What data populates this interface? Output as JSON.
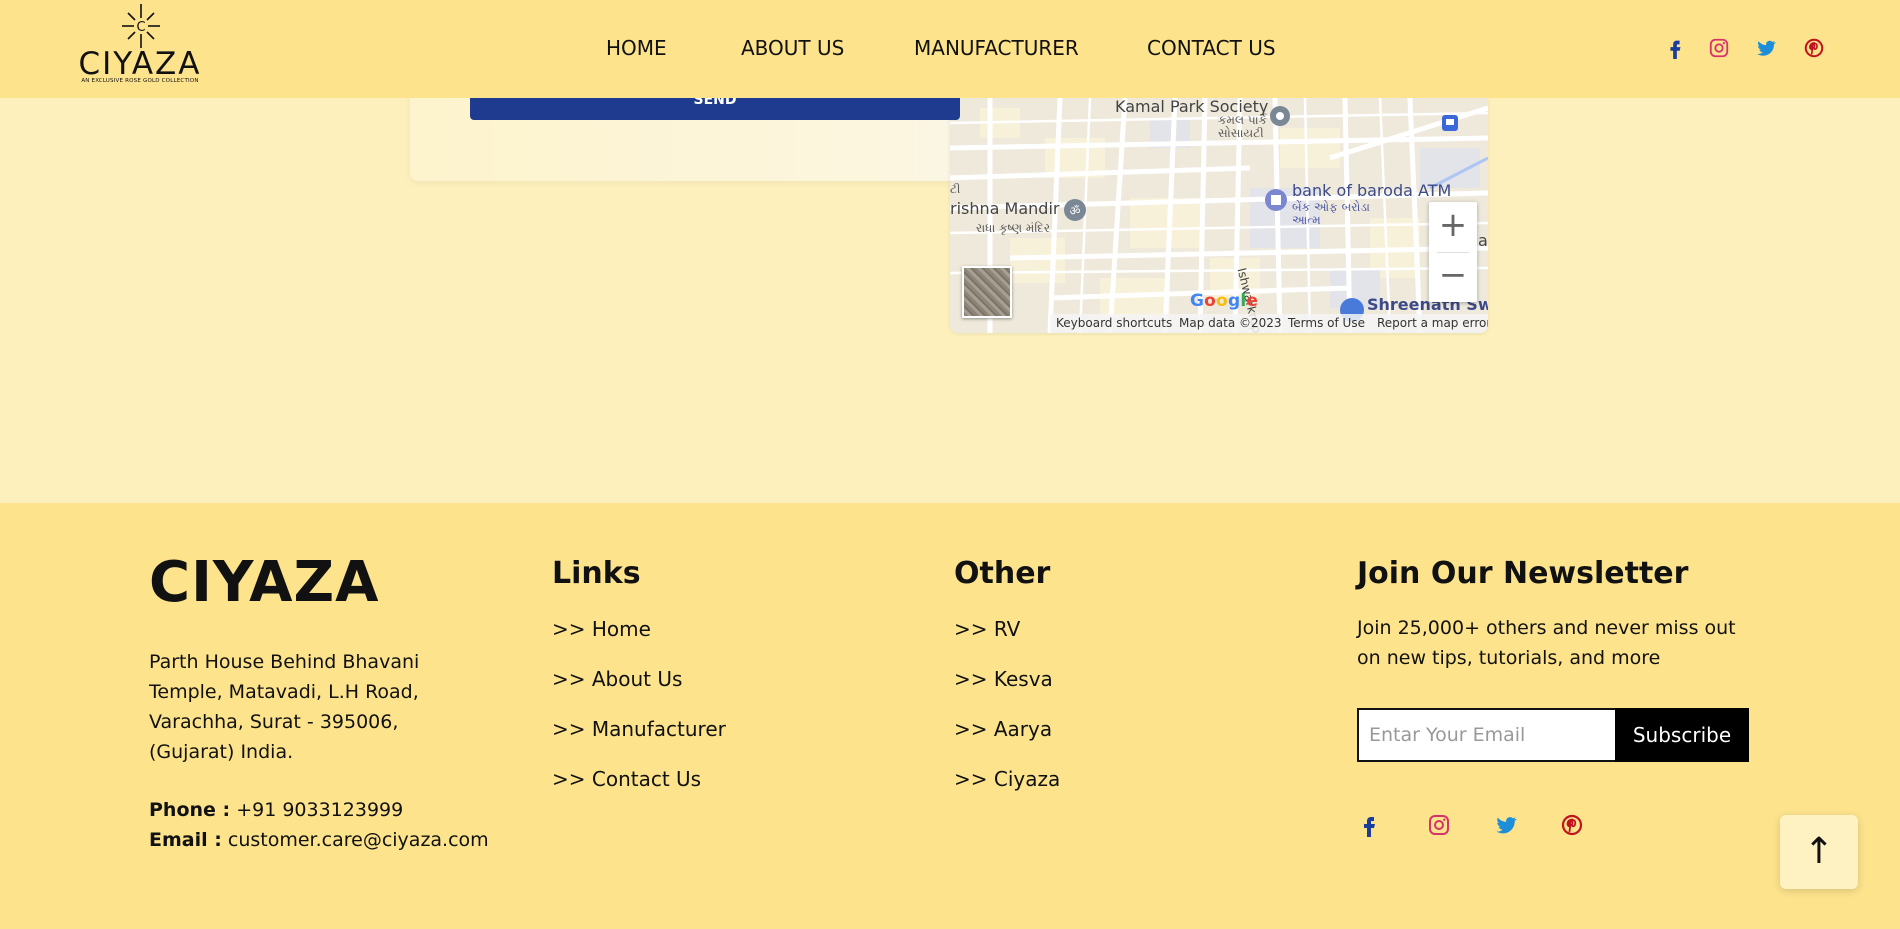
{
  "header": {
    "logo": {
      "name": "CIYAZA",
      "tagline": "AN EXCLUSIVE ROSE GOLD COLLECTION"
    },
    "nav": [
      "HOME",
      "ABOUT US",
      "MANUFACTURER",
      "CONTACT US"
    ],
    "social_icons": [
      "facebook-icon",
      "instagram-icon",
      "twitter-icon",
      "pinterest-icon"
    ]
  },
  "contact_form": {
    "send_label": "SEND"
  },
  "map": {
    "labels": {
      "kamal_park": "Kamal Park Society",
      "kamal_park_gu": "કમલ પાર્ક સોસાયટી",
      "bank": "bank of baroda ATM",
      "bank_gu": "બેંક ઓફ બરોડા આત્મ",
      "krishna": "rishna Mandir",
      "krishna_gu": "રાધા કૃષ્ણ મંદિર",
      "left_gu": "ટી",
      "street": "Ishwarkrupa",
      "shreenath": "Shreenath Swee",
      "edge": "a"
    },
    "google": "Google",
    "footer": [
      "Keyboard shortcuts",
      "Map data ©2023",
      "Terms of Use",
      "Report a map error"
    ],
    "zoom_in": "+",
    "zoom_out": "−"
  },
  "footer": {
    "brand": "CIYAZA",
    "address": "Parth House Behind Bhavani Temple, Matavadi, L.H Road, Varachha, Surat - 395006, (Gujarat) India.",
    "phone_label": "Phone :",
    "phone": "+91 9033123999",
    "email_label": "Email :",
    "email": "customer.care@ciyaza.com",
    "links_heading": "Links",
    "links": [
      ">> Home",
      ">> About Us",
      ">> Manufacturer",
      ">> Contact Us"
    ],
    "other_heading": "Other",
    "other": [
      ">> RV",
      ">> Kesva",
      ">> Aarya",
      ">> Ciyaza"
    ],
    "newsletter_heading": "Join Our Newsletter",
    "newsletter_text": "Join 25,000+ others and never miss out on new tips, tutorials, and more",
    "email_placeholder": "Entar Your Email",
    "subscribe_label": "Subscribe",
    "social_icons": [
      "facebook-icon",
      "instagram-icon",
      "twitter-icon",
      "pinterest-icon"
    ]
  },
  "scroll_top": "↑",
  "colors": {
    "header_bg": "#fce38c",
    "page_bg": "#fdf0bc",
    "send_button": "#1f3b8f",
    "facebook": "#1a3c9c",
    "instagram": "#d6336c",
    "twitter": "#1d8fd8",
    "pinterest": "#c1121f"
  }
}
